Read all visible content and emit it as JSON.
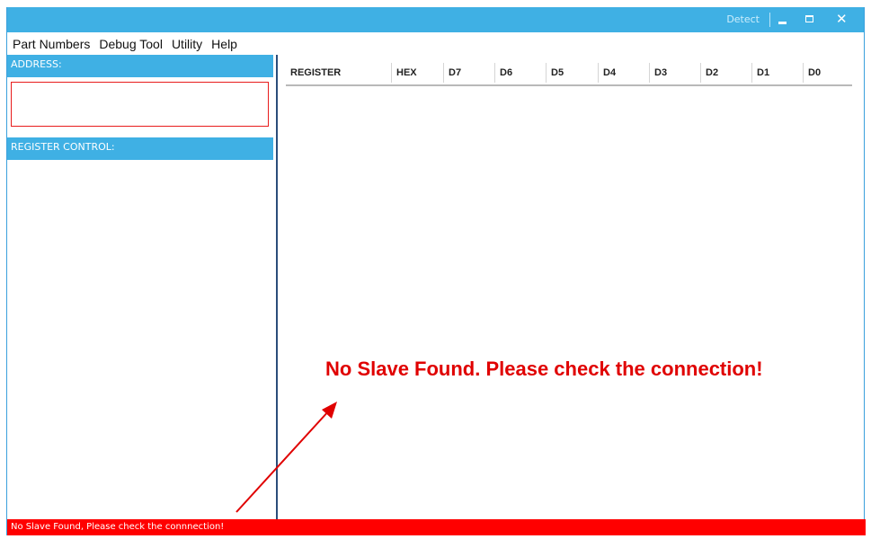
{
  "titlebar": {
    "detect_label": "Detect",
    "minimize_icon": "minimize-icon",
    "maximize_icon": "maximize-icon",
    "close_icon": "close-icon",
    "close_glyph": "✕"
  },
  "menu": {
    "items": [
      "Part Numbers",
      "Debug Tool",
      "Utility",
      "Help"
    ]
  },
  "left_panel": {
    "address_header": "ADDRESS:",
    "address_value": "",
    "register_control_header": "REGISTER CONTROL:"
  },
  "register_table": {
    "columns": [
      "REGISTER",
      "HEX",
      "D7",
      "D6",
      "D5",
      "D4",
      "D3",
      "D2",
      "D1",
      "D0"
    ]
  },
  "overlay": {
    "message": "No Slave Found. Please check the connection!"
  },
  "statusbar": {
    "text": "No Slave Found, Please check the connnection!"
  },
  "colors": {
    "accent": "#3fb0e4",
    "error": "#ff0000",
    "overlay_text": "#e00000",
    "divider": "#2b4d7a"
  }
}
